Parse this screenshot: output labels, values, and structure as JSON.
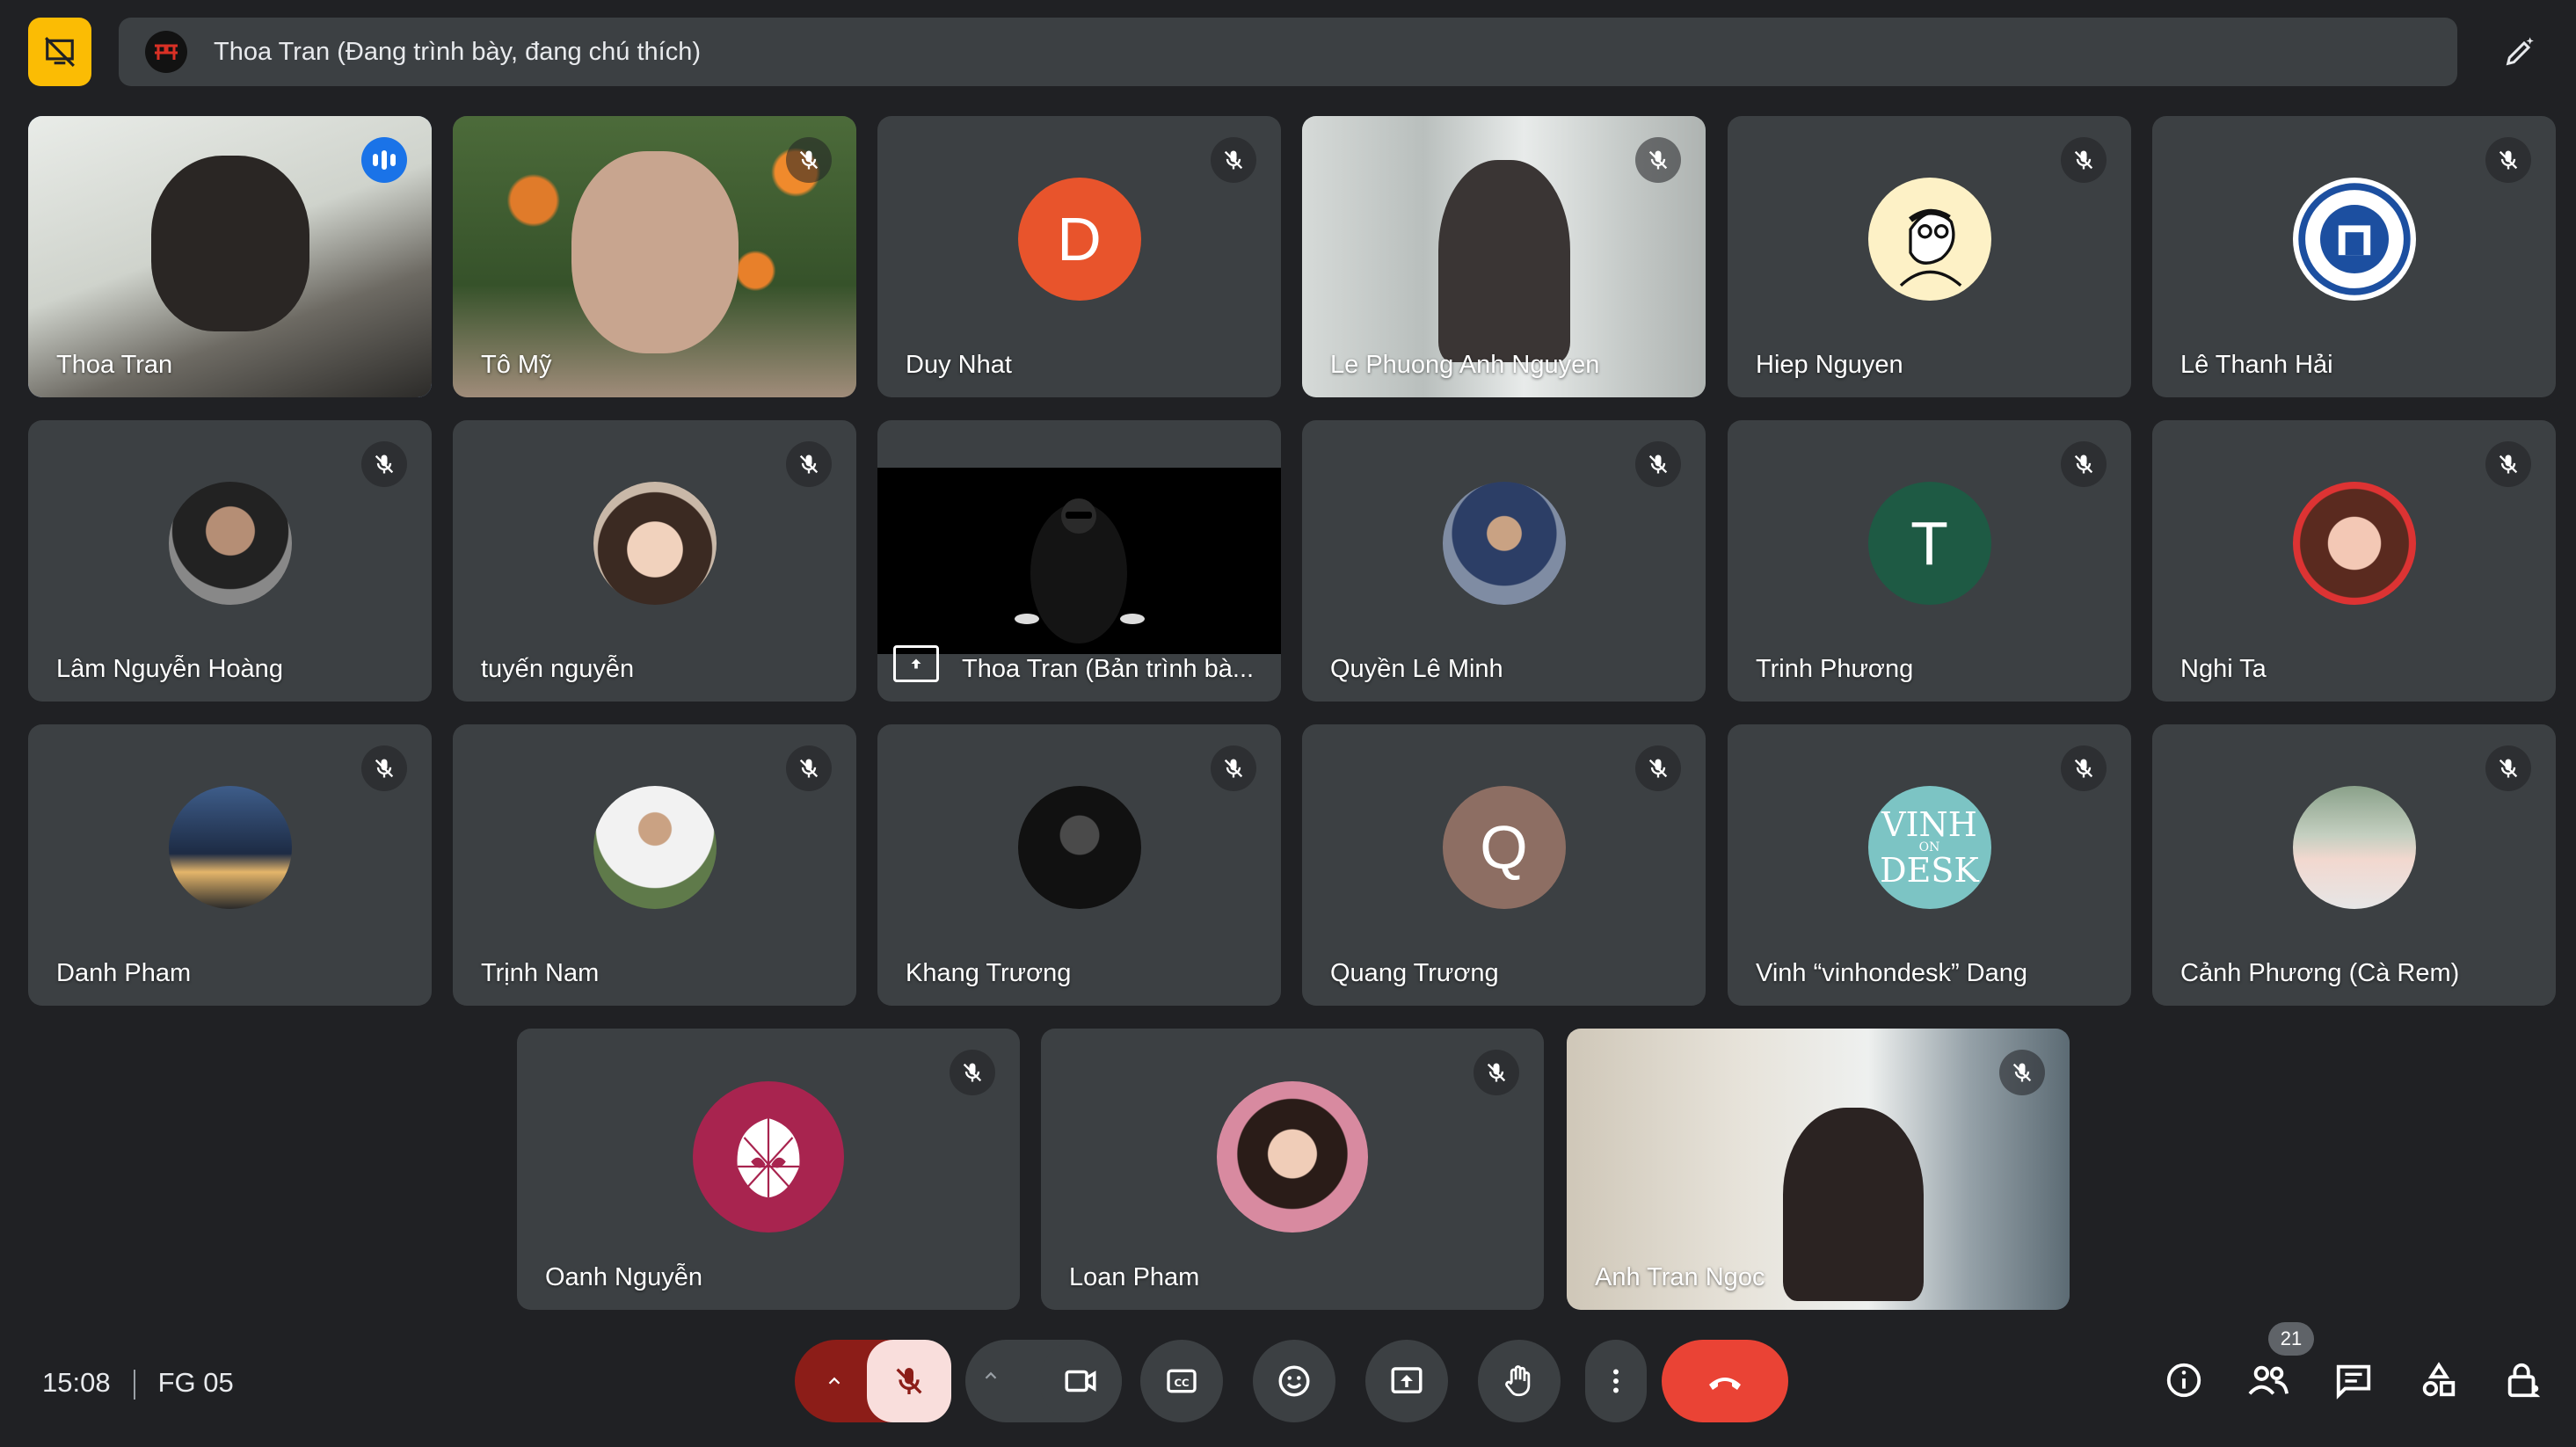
{
  "header": {
    "presentation_title": "Thoa Tran (Đang trình bày, đang chú thích)"
  },
  "tiles": [
    {
      "name": "Thoa Tran"
    },
    {
      "name": "Tô Mỹ"
    },
    {
      "name": "Duy Nhat",
      "initial": "D",
      "color": "#e8542c"
    },
    {
      "name": "Le Phuong Anh Nguyen"
    },
    {
      "name": "Hiep Nguyen"
    },
    {
      "name": "Lê Thanh Hải"
    },
    {
      "name": "Lâm Nguyễn Hoàng"
    },
    {
      "name": "tuyến nguyễn"
    },
    {
      "name": "Thoa Tran (Bản trình bà..."
    },
    {
      "name": "Quyền Lê Minh"
    },
    {
      "name": "Trinh Phương",
      "initial": "T",
      "color": "#1e5a44"
    },
    {
      "name": "Nghi Ta"
    },
    {
      "name": "Danh Pham"
    },
    {
      "name": "Trịnh Nam"
    },
    {
      "name": "Khang Trương"
    },
    {
      "name": "Quang Trương",
      "initial": "Q",
      "color": "#8d6e63"
    },
    {
      "name": "Vinh “vinhondesk” Dang",
      "logo_text": [
        "VINH",
        "ON",
        "DESK"
      ]
    },
    {
      "name": "Cảnh Phương (Cà Rem)"
    },
    {
      "name": "Oanh Nguyễn"
    },
    {
      "name": "Loan Pham"
    },
    {
      "name": "Anh Tran Ngoc"
    }
  ],
  "footer": {
    "time": "15:08",
    "meeting_code": "FG 05",
    "participant_count": "21"
  },
  "colors": {
    "background": "#202124",
    "tile": "#3c4043",
    "accent": "#8ab4f8",
    "end_call": "#ea4335",
    "present_highlight": "#fbbc04"
  }
}
